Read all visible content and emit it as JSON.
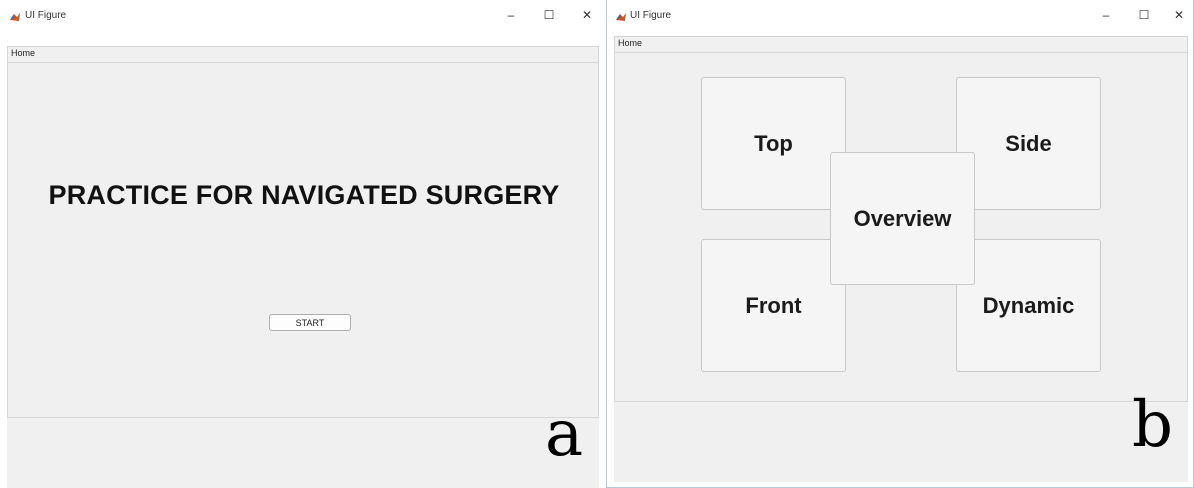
{
  "windows": {
    "a": {
      "title": "UI Figure",
      "controls": {
        "minimize": "–",
        "maximize": "☐",
        "close": "✕"
      },
      "tab": "Home",
      "heading": "PRACTICE FOR NAVIGATED SURGERY",
      "start_button": "START",
      "panel_label": "a"
    },
    "b": {
      "title": "UI Figure",
      "controls": {
        "minimize": "–",
        "maximize": "☐",
        "close": "✕"
      },
      "tab": "Home",
      "buttons": {
        "top": "Top",
        "side": "Side",
        "overview": "Overview",
        "front": "Front",
        "dynamic": "Dynamic"
      },
      "panel_label": "b"
    }
  },
  "icons": {
    "app": "matlab-icon"
  }
}
